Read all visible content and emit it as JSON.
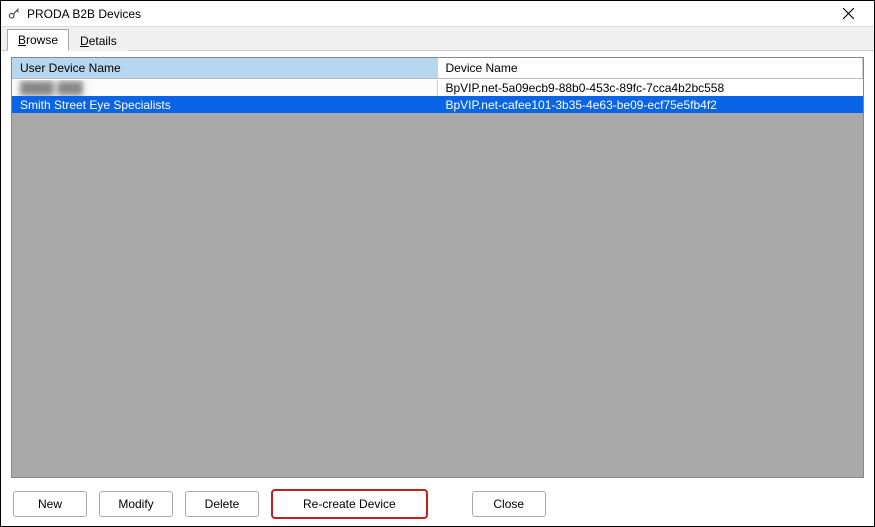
{
  "window": {
    "title": "PRODA B2B Devices"
  },
  "tabs": {
    "browse": "Browse",
    "details": "Details",
    "active": "browse"
  },
  "grid": {
    "headers": [
      "User Device Name",
      "Device Name"
    ],
    "rows": [
      {
        "user_device": "████ ███",
        "device_name": "BpVIP.net-5a09ecb9-88b0-453c-89fc-7cca4b2bc558",
        "redacted": true,
        "selected": false
      },
      {
        "user_device": "Smith Street Eye Specialists",
        "device_name": "BpVIP.net-cafee101-3b35-4e63-be09-ecf75e5fb4f2",
        "redacted": false,
        "selected": true
      }
    ]
  },
  "buttons": {
    "new": "New",
    "modify": "Modify",
    "delete": "Delete",
    "recreate": "Re-create Device",
    "close": "Close"
  }
}
